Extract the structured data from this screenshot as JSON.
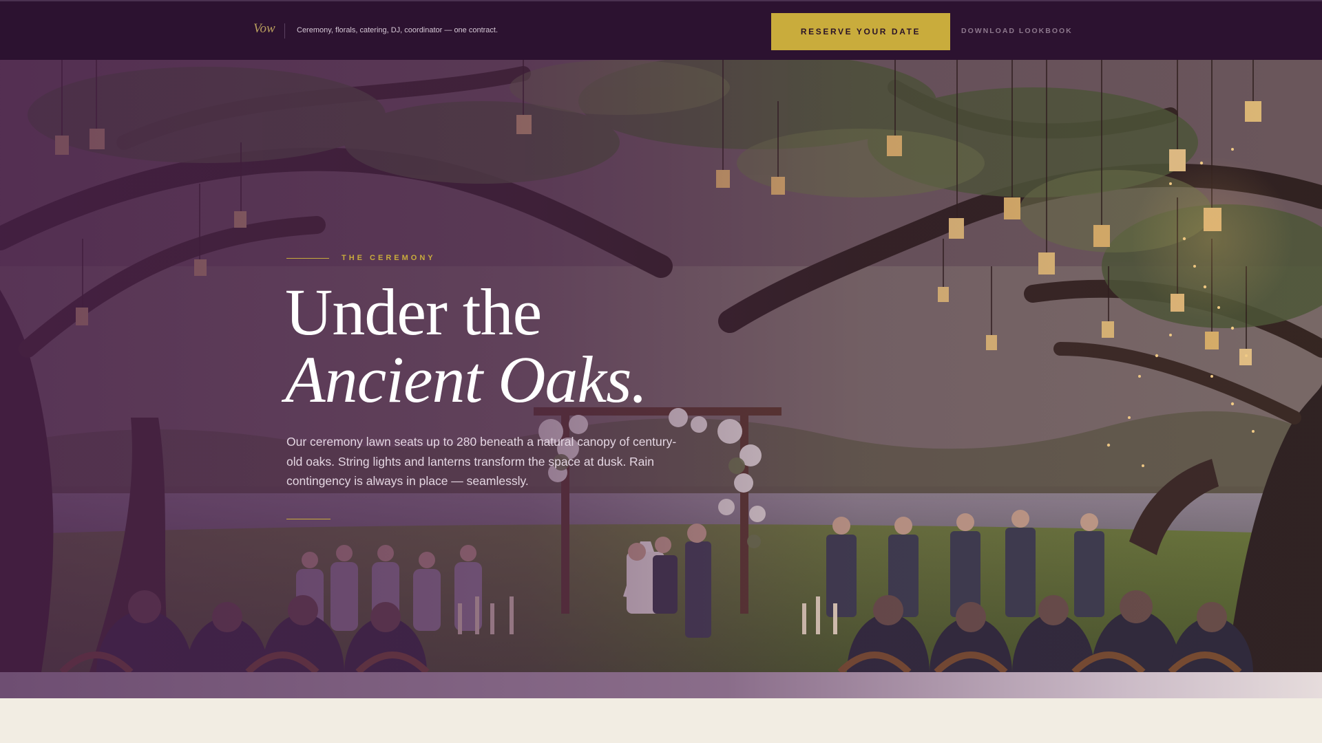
{
  "header": {
    "brand": "Vow",
    "tagline": "Ceremony, florals, catering, DJ, coordinator — one contract.",
    "reserve_label": "RESERVE YOUR DATE",
    "lookbook_label": "DOWNLOAD LOOKBOOK"
  },
  "hero": {
    "eyebrow": "THE CEREMONY",
    "headline_line1": "Under the",
    "headline_line2": "Ancient Oaks.",
    "body": "Our ceremony lawn seats up to 280 beneath a natural canopy of century-old oaks. String lights and lanterns transform the space at dusk. Rain contingency is always in place — seamlessly."
  },
  "colors": {
    "nav_background": "#2c1230",
    "accent_gold": "#c9ac3c",
    "overlay_plum": "#4a1e4e",
    "page_cream": "#f2ede3"
  }
}
